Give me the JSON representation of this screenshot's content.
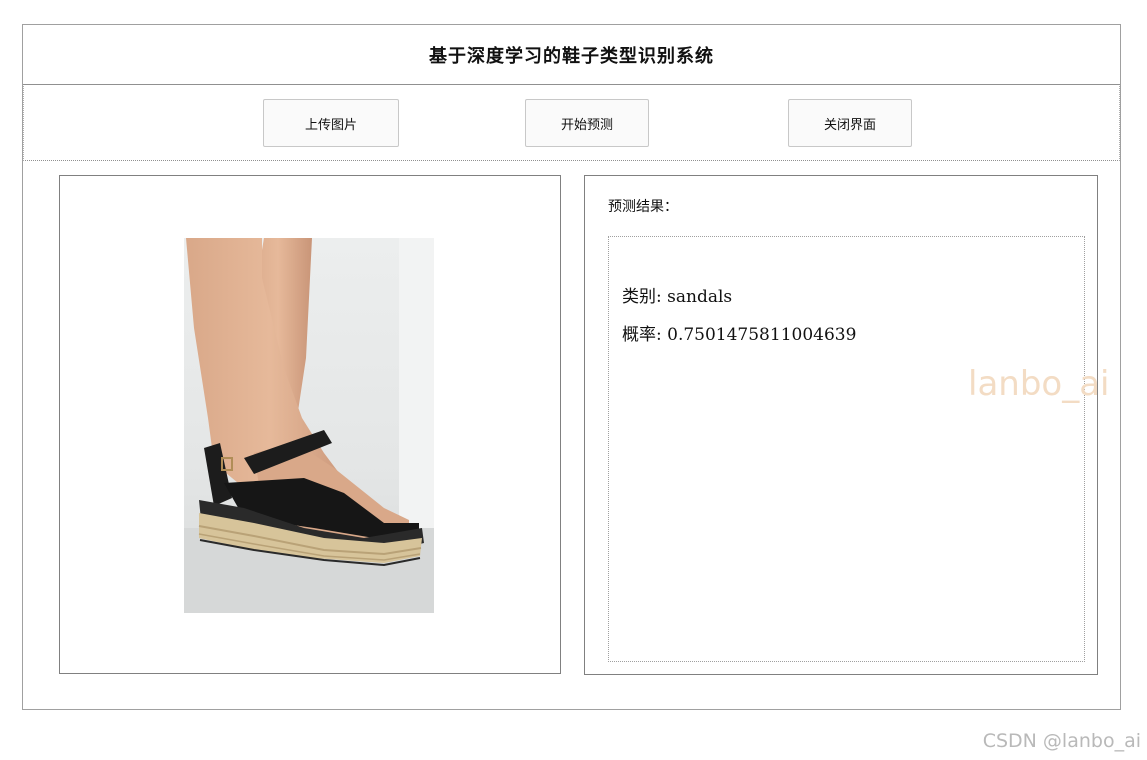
{
  "window": {
    "title": "基于深度学习的鞋子类型识别系统"
  },
  "toolbar": {
    "upload_label": "上传图片",
    "predict_label": "开始预测",
    "close_label": "关闭界面"
  },
  "image_panel": {
    "image_semantic": "sandal-photo"
  },
  "result": {
    "heading": "预测结果：",
    "class_line": "类别: sandals",
    "prob_line": "概率: 0.7501475811004639"
  },
  "watermarks": {
    "inner": "lanbo_ai",
    "footer": "CSDN @lanbo_ai"
  },
  "colors": {
    "watermark_inner": "#f3dcc4",
    "watermark_footer": "#b9b9b9",
    "border": "#808080"
  }
}
